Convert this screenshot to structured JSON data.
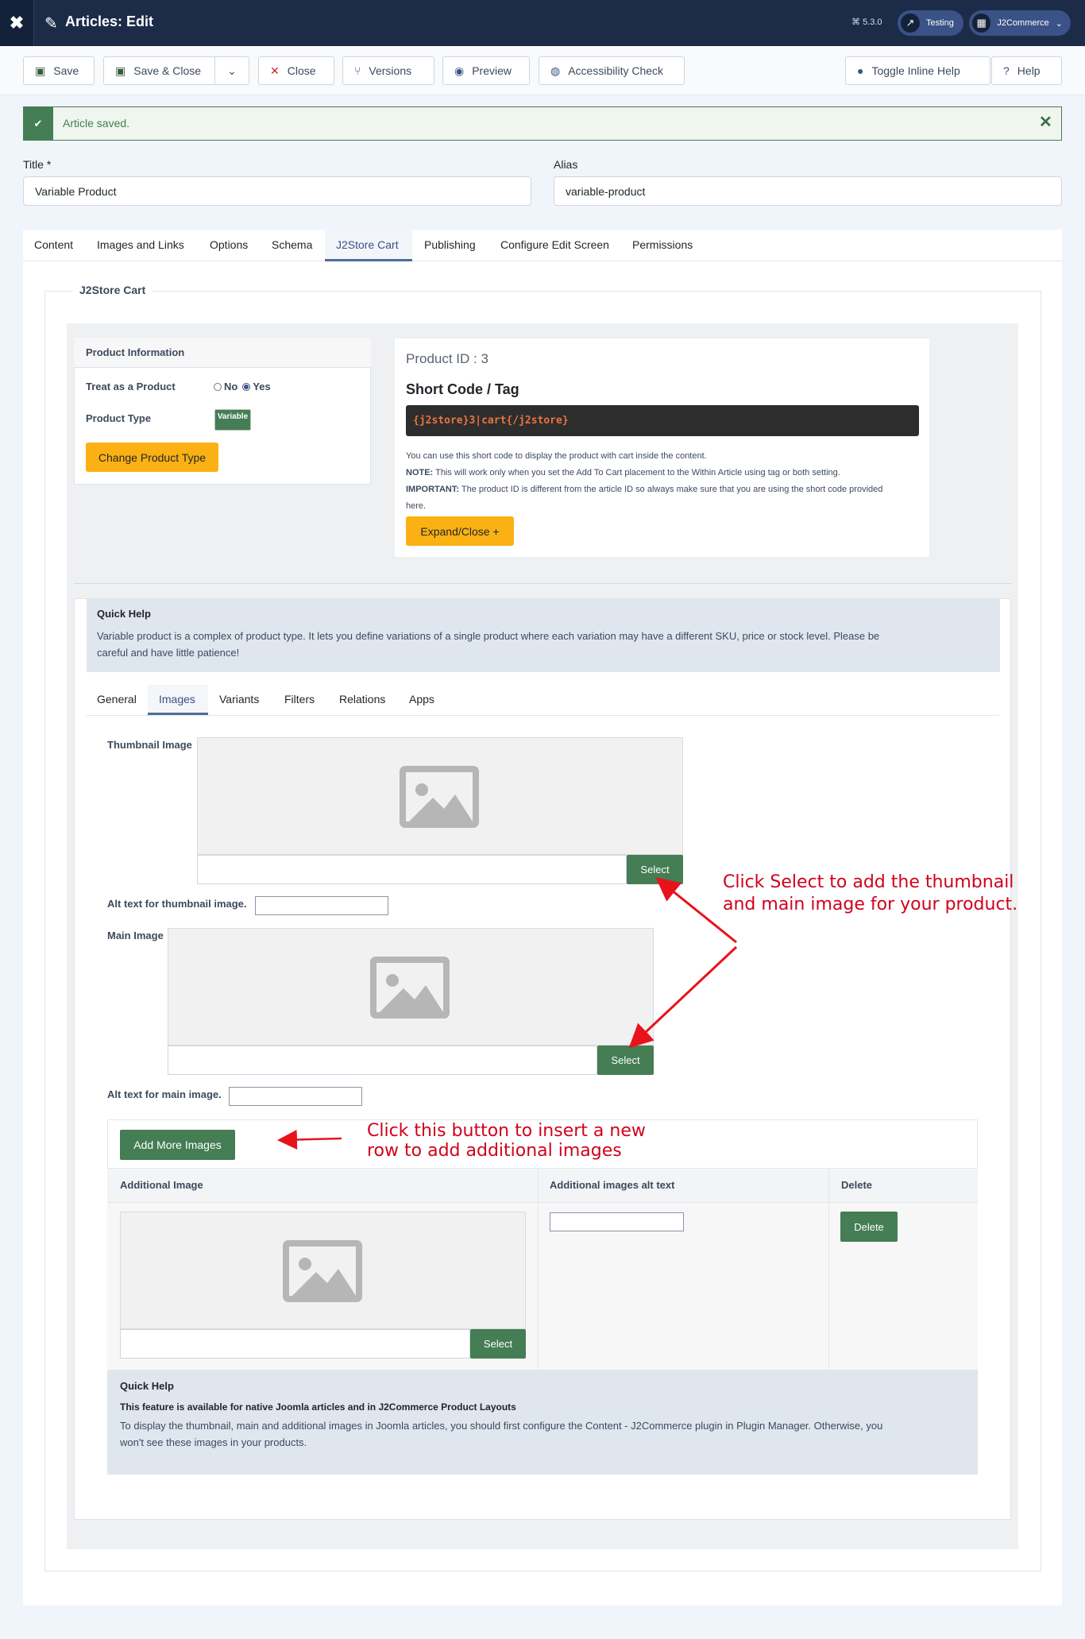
{
  "header": {
    "title": "Articles: Edit",
    "version": "5.3.0",
    "site_pill": "Testing",
    "user_pill": "J2Commerce"
  },
  "toolbar": {
    "save": "Save",
    "save_close": "Save & Close",
    "close": "Close",
    "versions": "Versions",
    "preview": "Preview",
    "accessibility": "Accessibility Check",
    "toggle_help": "Toggle Inline Help",
    "help": "Help"
  },
  "alert": {
    "message": "Article saved."
  },
  "fields": {
    "title_label": "Title *",
    "title_value": "Variable Product",
    "alias_label": "Alias",
    "alias_value": "variable-product"
  },
  "tabs": [
    "Content",
    "Images and Links",
    "Options",
    "Schema",
    "J2Store Cart",
    "Publishing",
    "Configure Edit Screen",
    "Permissions"
  ],
  "active_tab": "J2Store Cart",
  "legend": "J2Store Cart",
  "product_info": {
    "heading": "Product Information",
    "treat_label": "Treat as a Product",
    "no": "No",
    "yes": "Yes",
    "selected": "Yes",
    "type_label": "Product Type",
    "type_badge": "Variable",
    "change_btn": "Change Product Type"
  },
  "shortcode": {
    "product_id": "Product ID : 3",
    "heading": "Short Code / Tag",
    "code": "{j2store}3|cart{/j2store}",
    "line1": "You can use this short code to display the product with cart inside the content.",
    "note_label": "NOTE:",
    "note": "This will work only when you set the Add To Cart placement to the Within Article using tag or both setting.",
    "important_label": "IMPORTANT:",
    "important": "The product ID is different from the article ID so always make sure that you are using the short code provided",
    "important_end": "here.",
    "expand_btn": "Expand/Close +"
  },
  "quick_help_1": {
    "title": "Quick Help",
    "line1": "Variable product is a complex of product type. It lets you define variations of a single product where each variation may have a different SKU, price or stock level. Please be",
    "line2": "careful and have little patience!"
  },
  "subtabs": [
    "General",
    "Images",
    "Variants",
    "Filters",
    "Relations",
    "Apps"
  ],
  "active_subtab": "Images",
  "images": {
    "thumb_label": "Thumbnail Image",
    "select": "Select",
    "thumb_alt_label": "Alt text for thumbnail image.",
    "main_label": "Main Image",
    "main_alt_label": "Alt text for main image.",
    "add_more": "Add More Images",
    "col_image": "Additional Image",
    "col_alt": "Additional images alt text",
    "col_delete": "Delete",
    "delete_btn": "Delete"
  },
  "annotations": {
    "select_line1": "Click Select to add the thumbnail",
    "select_line2": "and main image for your product.",
    "add_line1": "Click this button to insert a new",
    "add_line2": "row to add additional images"
  },
  "quick_help_2": {
    "title": "Quick Help",
    "subtitle": "This feature is available for native Joomla articles and in J2Commerce Product Layouts",
    "line1": "To display the thumbnail, main and additional images in Joomla articles, you should first configure the Content - J2Commerce plugin in Plugin Manager. Otherwise, you",
    "line2": "won't see these images in your products."
  },
  "colors": {
    "accent": "#457d54",
    "header": "#1c2c48",
    "warning": "#fbb113",
    "annotation": "#d0021b"
  }
}
